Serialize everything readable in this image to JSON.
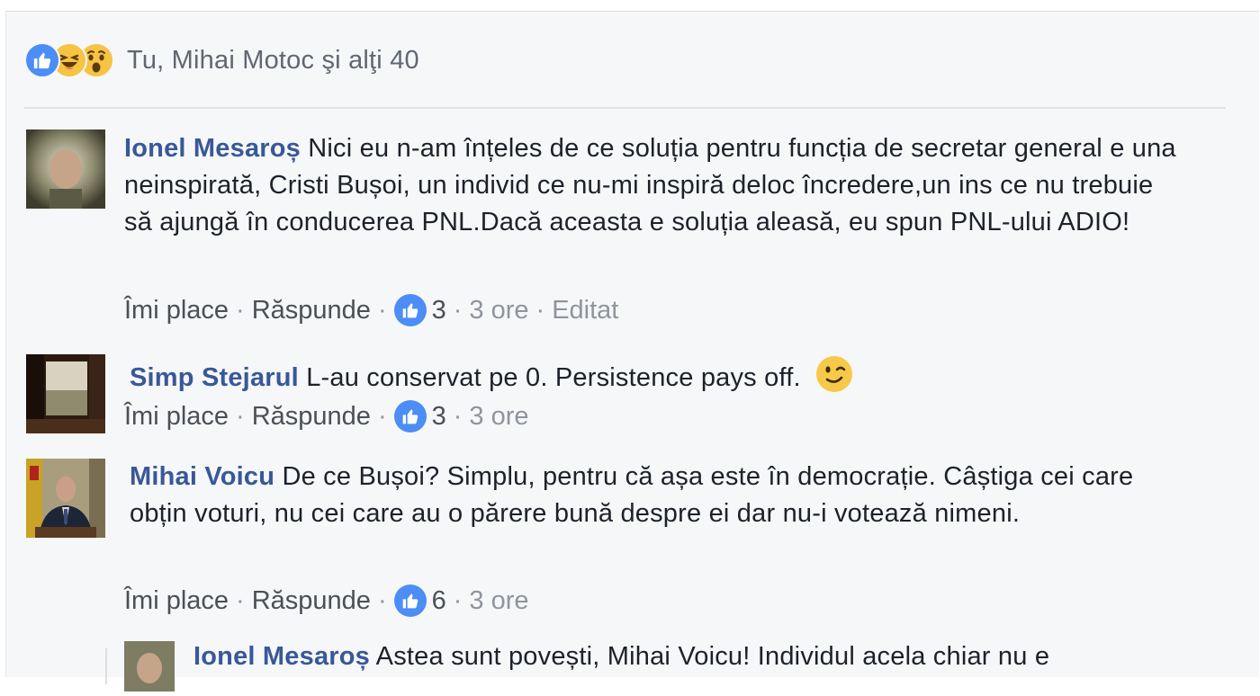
{
  "reactions": {
    "icons": [
      "like-icon",
      "haha-icon",
      "wow-icon"
    ],
    "summary": "Tu, Mihai Motoc şi alţi 40"
  },
  "comments": [
    {
      "author": "Ionel Mesaroș",
      "text": "Nici eu n-am înțeles de ce soluția pentru funcția de secretar general e una neinspirată, Cristi Bușoi, un individ ce nu-mi inspiră deloc încredere,un ins ce nu trebuie să ajungă în conducerea PNL.Dacă aceasta e soluția aleasă, eu spun PNL-ului ADIO!",
      "like_label": "Îmi place",
      "reply_label": "Răspunde",
      "like_count": "3",
      "time": "3 ore",
      "edited": "Editat"
    },
    {
      "author": "Simp Stejarul",
      "text": "L-au conservat pe 0. Persistence pays off.",
      "like_label": "Îmi place",
      "reply_label": "Răspunde",
      "like_count": "3",
      "time": "3 ore"
    },
    {
      "author": "Mihai Voicu",
      "text": "De ce Bușoi? Simplu, pentru că așa este în democrație. Câștiga cei care obțin voturi, nu cei care au o părere bună despre ei dar nu-i votează nimeni.",
      "like_label": "Îmi place",
      "reply_label": "Răspunde",
      "like_count": "6",
      "time": "3 ore"
    },
    {
      "author": "Ionel Mesaroș",
      "text": "Astea sunt povești, Mihai Voicu! Individul acela chiar nu e"
    }
  ],
  "separator": "·",
  "colors": {
    "author": "#385898",
    "like_blue": "#4c8df6",
    "meta_gray": "#90949c",
    "background": "#f6f7f9"
  }
}
